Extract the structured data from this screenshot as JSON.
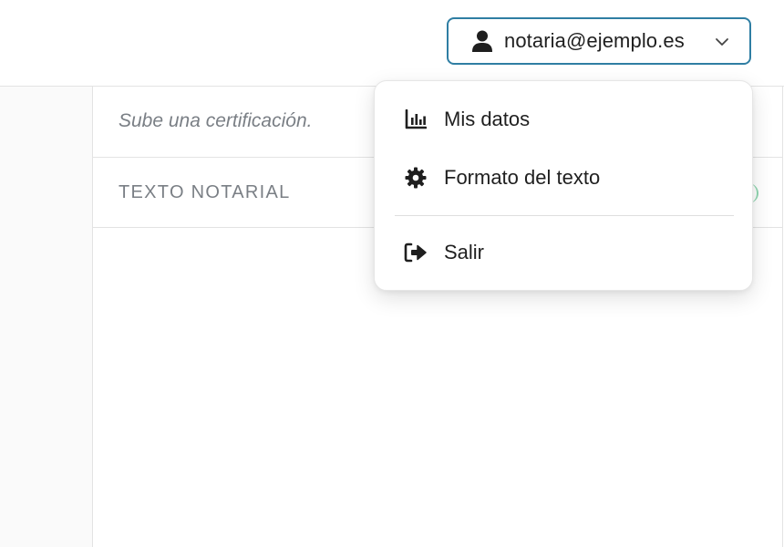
{
  "header": {
    "user_email": "notaria@ejemplo.es",
    "icons": {
      "user": "person-icon",
      "toggle": "chevron-down-icon"
    },
    "accent_color": "#2f7ea3"
  },
  "panel": {
    "prompt": "Sube una certificación.",
    "section_title": "TEXTO NOTARIAL"
  },
  "user_menu": {
    "items": [
      {
        "label": "Mis datos",
        "icon": "bar-chart-icon"
      },
      {
        "label": "Formato del texto",
        "icon": "gear-icon"
      },
      {
        "label": "Salir",
        "icon": "logout-icon"
      }
    ]
  }
}
